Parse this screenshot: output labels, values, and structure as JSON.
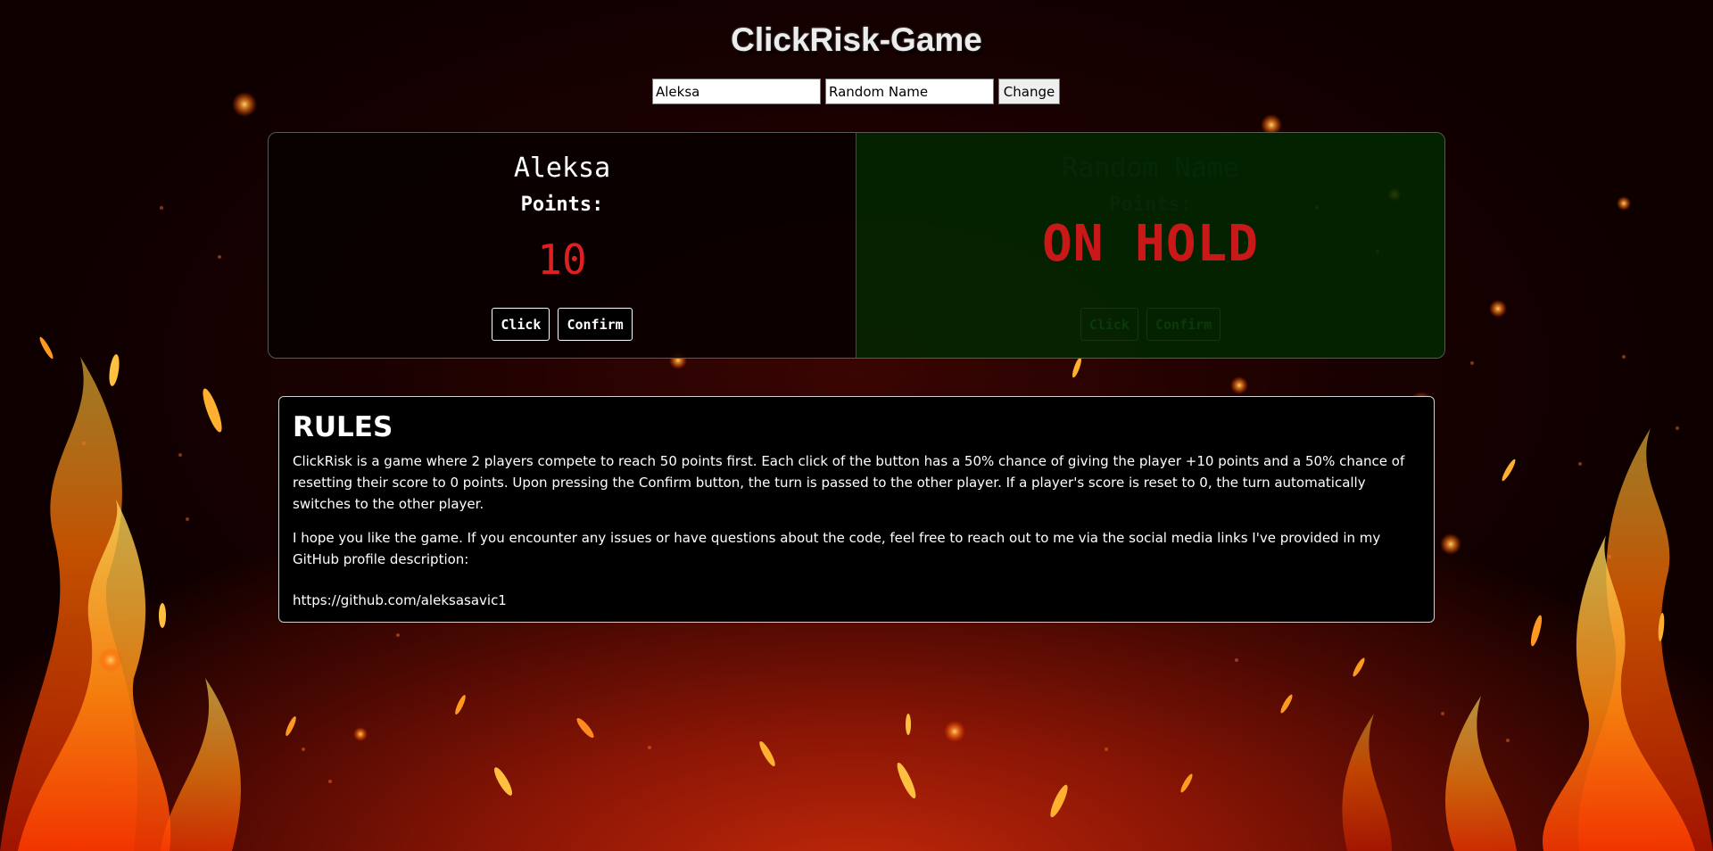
{
  "title": "ClickRisk-Game",
  "name_form": {
    "player1_value": "Aleksa",
    "player2_value": "Random Name",
    "change_label": "Change"
  },
  "players": [
    {
      "name": "Aleksa",
      "points_label": "Points:",
      "score": "10",
      "click_label": "Click",
      "confirm_label": "Confirm",
      "status": "active"
    },
    {
      "name": "Random Name",
      "points_label": "Points:",
      "score": "",
      "click_label": "Click",
      "confirm_label": "Confirm",
      "status": "on-hold",
      "overlay": "ON HOLD"
    }
  ],
  "rules": {
    "heading": "RULES",
    "paragraph1": "ClickRisk is a game where 2 players compete to reach 50 points first. Each click of the button has a 50% chance of giving the player +10 points and a 50% chance of resetting their score to 0 points. Upon pressing the Confirm button, the turn is passed to the other player. If a player's score is reset to 0, the turn automatically switches to the other player.",
    "paragraph2": "I hope you like the game. If you encounter any issues or have questions about the code, feel free to reach out to me via the social media links I've provided in my GitHub profile description:",
    "link": "https://github.com/aleksasavic1"
  },
  "colors": {
    "score": "#e02020",
    "on_hold": "#c81818",
    "hold_panel": "#002800"
  }
}
